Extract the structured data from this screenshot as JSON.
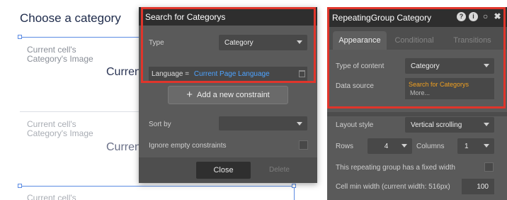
{
  "canvas": {
    "title": "Choose a category",
    "cells": [
      {
        "image_label": "Current cell's Category's Image",
        "name_label": "Curren"
      },
      {
        "image_label": "Current cell's Category's Image",
        "name_label": "Curren"
      },
      {
        "image_label": "Current cell's"
      }
    ]
  },
  "search": {
    "title": "Search for Categorys",
    "type_label": "Type",
    "type_value": "Category",
    "constraint_key": "Language =",
    "constraint_value": "Current Page Language",
    "add_constraint": "Add a new constraint",
    "sort_label": "Sort by",
    "sort_value": "",
    "ignore_label": "Ignore empty constraints",
    "close": "Close",
    "delete": "Delete"
  },
  "props": {
    "title": "RepeatingGroup Category",
    "tabs": [
      "Appearance",
      "Conditional",
      "Transitions"
    ],
    "type_label": "Type of content",
    "type_value": "Category",
    "source_label": "Data source",
    "source_value": "Search for Categorys",
    "source_more": "More...",
    "layout_label": "Layout style",
    "layout_value": "Vertical scrolling",
    "rows_label": "Rows",
    "rows_value": "4",
    "columns_label": "Columns",
    "columns_value": "1",
    "fixed_label": "This repeating group has a fixed width",
    "minwidth_label": "Cell min width (current width: 516px)",
    "minwidth_value": "100"
  },
  "colors": {
    "highlight": "#e0352b",
    "link": "#4da3ff",
    "expression": "#f0a020",
    "panel": "#5a5a5a",
    "header": "#2e2e2e"
  },
  "icons": [
    "help-icon",
    "info-icon",
    "comment-icon",
    "close-icon",
    "trash-icon",
    "plus-icon",
    "chevron-down-icon"
  ]
}
